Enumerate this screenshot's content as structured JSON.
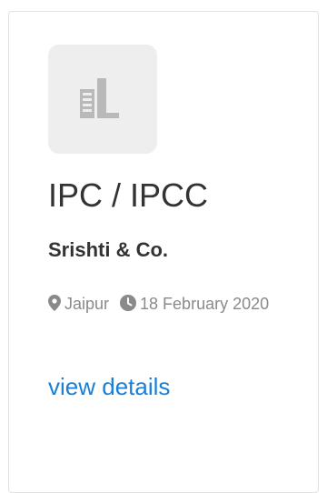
{
  "card": {
    "logo_icon": "building-icon",
    "title": "IPC / IPCC",
    "company": "Srishti & Co.",
    "location_icon": "map-marker-icon",
    "location": "Jaipur",
    "date_icon": "clock-icon",
    "date": "18 February 2020",
    "details_link": "view details"
  },
  "colors": {
    "title": "#333333",
    "meta": "#8a8a8a",
    "link": "#1a7fd6",
    "logo_bg": "#eeeeee",
    "logo_fg": "#b9b9b9"
  }
}
